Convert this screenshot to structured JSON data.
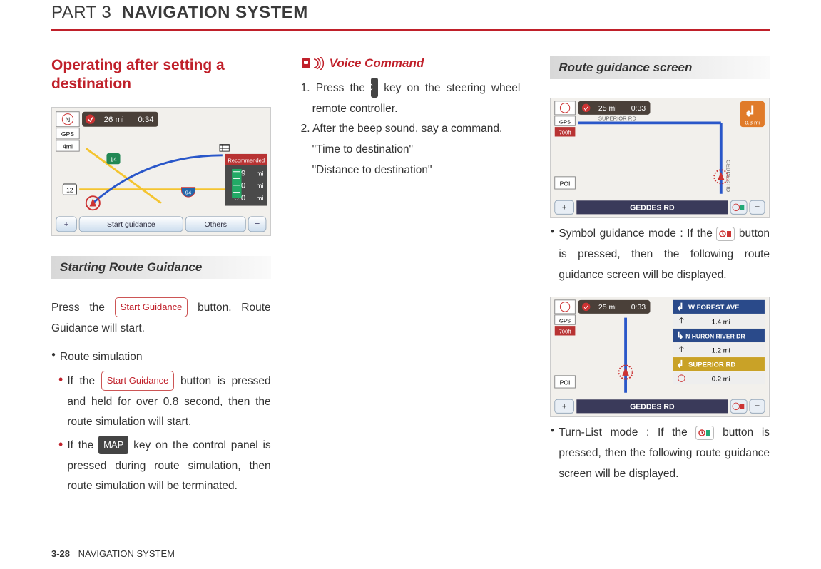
{
  "header": {
    "part": "PART 3",
    "title": "NAVIGATION SYSTEM"
  },
  "left": {
    "section_title": "Operating after setting a destination",
    "sub_heading": "Starting Route Guidance",
    "start_btn": "Start Guidance",
    "map_key": "MAP",
    "p1_a": "Press the ",
    "p1_b": " button. Route Guidance will start.",
    "b1": "Route simulation",
    "b2_a": "If the ",
    "b2_b": " button is pressed and held for over 0.8  second, then the route simulation will start.",
    "b3_a": "If the ",
    "b3_b": " key on the control panel is pressed during route simulation, then route simulation will be terminated.",
    "shot": {
      "dist": "26 mi",
      "time": "0:34",
      "btn_start": "Start guidance",
      "btn_others": "Others",
      "rec": "Recommended",
      "v1": "19",
      "v2": "0.0",
      "v3": "0.0",
      "unit": "mi",
      "gps": "GPS",
      "scale": "4mi"
    }
  },
  "mid": {
    "voice_heading": "Voice Command",
    "step1_a": "Press the ",
    "step1_b": " key on the steering wheel remote controller.",
    "step2": "After the beep sound, say a command.",
    "q1": "\"Time to destination\"",
    "q2": "\"Distance to destination\""
  },
  "right": {
    "sub_heading": "Route guidance screen",
    "shot": {
      "dist": "25 mi",
      "time": "0:33",
      "gps": "GPS",
      "scale": "700ft",
      "road": "GEDDES RD",
      "turn": "0.3 mi",
      "label1": "SUPERIOR RD",
      "label2": "GEDDES RD",
      "poi": "POI"
    },
    "b1_a": "Symbol guidance mode : If the ",
    "b1_b": " button is pressed, then the following route guidance screen will be displayed.",
    "shot2": {
      "dist": "25 mi",
      "time": "0:33",
      "gps": "GPS",
      "scale": "700ft",
      "road": "GEDDES RD",
      "poi": "POI",
      "r1": "W FOREST AVE",
      "d1": "1.4 mi",
      "r2": "N HURON RIVER DR",
      "d2": "1.2 mi",
      "r3": "SUPERIOR RD",
      "d3": "0.2 mi"
    },
    "b2_a": "Turn-List mode : If the ",
    "b2_b": " button is pressed, then the following route guidance screen will be displayed."
  },
  "footer": {
    "page": "3-28",
    "label": "NAVIGATION SYSTEM"
  }
}
